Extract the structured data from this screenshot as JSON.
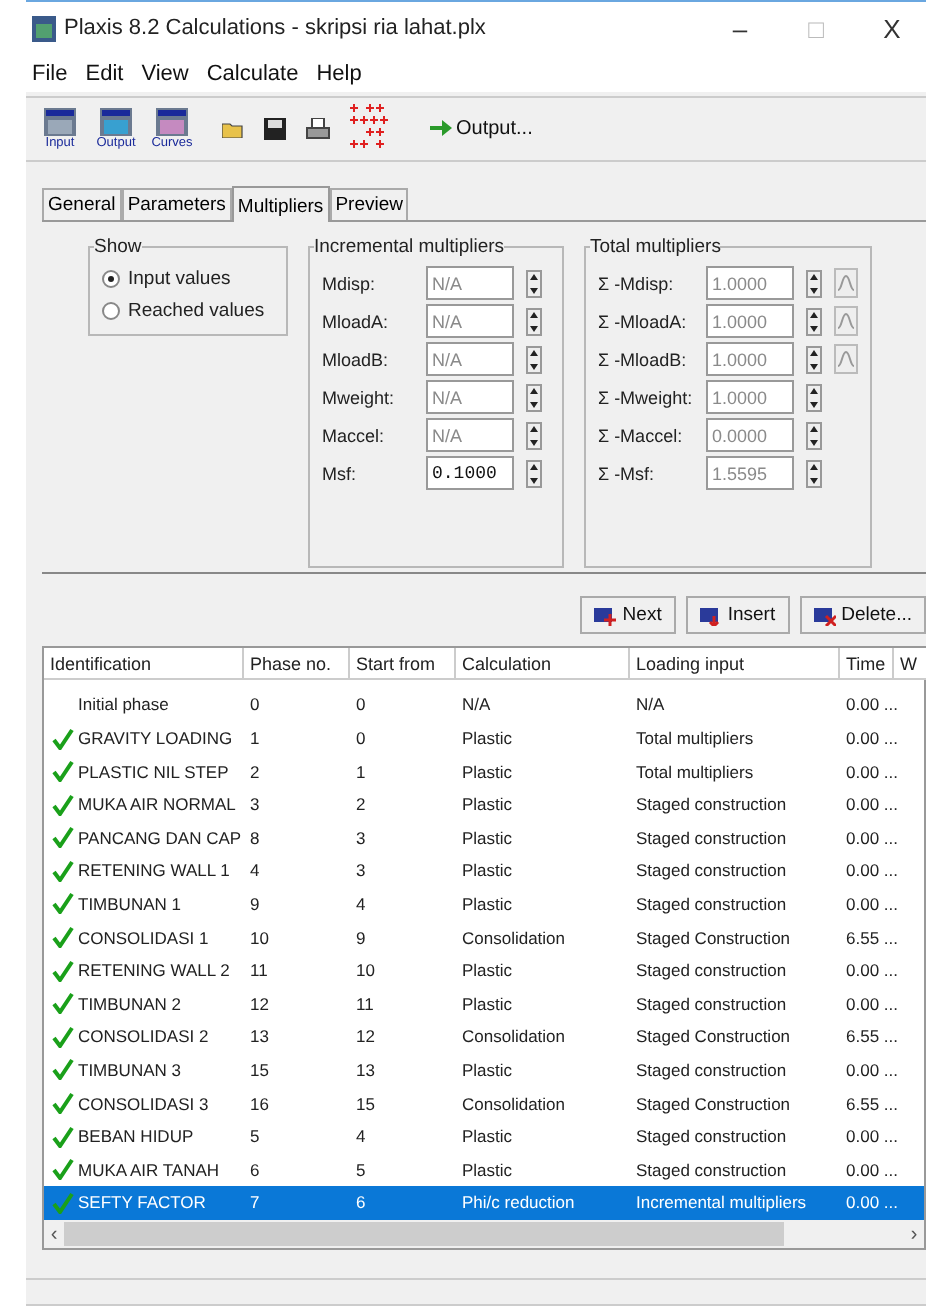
{
  "window": {
    "title": "Plaxis 8.2 Calculations - skripsi ria lahat.plx",
    "controls": [
      "–",
      "□",
      "X"
    ]
  },
  "menu": [
    "File",
    "Edit",
    "View",
    "Calculate",
    "Help"
  ],
  "toolbar": [
    {
      "kind": "big",
      "label": "Input"
    },
    {
      "kind": "big",
      "label": "Output"
    },
    {
      "kind": "big",
      "label": "Curves"
    },
    {
      "kind": "open"
    },
    {
      "kind": "save"
    },
    {
      "kind": "print"
    },
    {
      "kind": "grid"
    },
    {
      "kind": "output",
      "label": "Output..."
    }
  ],
  "tabs": [
    {
      "label": "General",
      "selected": false
    },
    {
      "label": "Parameters",
      "selected": false
    },
    {
      "label": "Multipliers",
      "selected": true
    },
    {
      "label": "Preview",
      "selected": false
    }
  ],
  "show": {
    "title": "Show",
    "options": [
      {
        "label": "Input values",
        "selected": true
      },
      {
        "label": "Reached values",
        "selected": false
      }
    ]
  },
  "incremental": {
    "title": "Incremental multipliers",
    "fields": [
      {
        "label": "Mdisp:",
        "value": "N/A",
        "disabled": true
      },
      {
        "label": "MloadA:",
        "value": "N/A",
        "disabled": true
      },
      {
        "label": "MloadB:",
        "value": "N/A",
        "disabled": true
      },
      {
        "label": "Mweight:",
        "value": "N/A",
        "disabled": true
      },
      {
        "label": "Maccel:",
        "value": "N/A",
        "disabled": true
      },
      {
        "label": "Msf:",
        "value": "0.1000",
        "disabled": false
      }
    ]
  },
  "total": {
    "title": "Total multipliers",
    "fields": [
      {
        "label": "Σ -Mdisp:",
        "value": "1.0000",
        "wave": true
      },
      {
        "label": "Σ -MloadA:",
        "value": "1.0000",
        "wave": true
      },
      {
        "label": "Σ -MloadB:",
        "value": "1.0000",
        "wave": true
      },
      {
        "label": "Σ -Mweight:",
        "value": "1.0000",
        "wave": false
      },
      {
        "label": "Σ -Maccel:",
        "value": "0.0000",
        "wave": false
      },
      {
        "label": "Σ -Msf:",
        "value": "1.5595",
        "wave": false
      }
    ]
  },
  "buttons": [
    {
      "kind": "next",
      "label": "Next"
    },
    {
      "kind": "insert",
      "label": "Insert"
    },
    {
      "kind": "delete",
      "label": "Delete..."
    }
  ],
  "table": {
    "columns": [
      "Identification",
      "Phase no.",
      "Start from",
      "Calculation",
      "Loading input",
      "Time",
      "W"
    ],
    "rows": [
      {
        "checked": false,
        "selected": false,
        "cells": [
          "Initial phase",
          "0",
          "0",
          "N/A",
          "N/A",
          "0.00 ..."
        ]
      },
      {
        "checked": true,
        "selected": false,
        "cells": [
          "GRAVITY LOADING",
          "1",
          "0",
          "Plastic",
          "Total multipliers",
          "0.00 ..."
        ]
      },
      {
        "checked": true,
        "selected": false,
        "cells": [
          "PLASTIC NIL STEP",
          "2",
          "1",
          "Plastic",
          "Total multipliers",
          "0.00 ..."
        ]
      },
      {
        "checked": true,
        "selected": false,
        "cells": [
          "MUKA AIR NORMAL",
          "3",
          "2",
          "Plastic",
          "Staged construction",
          "0.00 ..."
        ]
      },
      {
        "checked": true,
        "selected": false,
        "cells": [
          "PANCANG DAN CAP",
          "8",
          "3",
          "Plastic",
          "Staged construction",
          "0.00 ..."
        ]
      },
      {
        "checked": true,
        "selected": false,
        "cells": [
          "RETENING WALL 1",
          "4",
          "3",
          "Plastic",
          "Staged construction",
          "0.00 ..."
        ]
      },
      {
        "checked": true,
        "selected": false,
        "cells": [
          "TIMBUNAN 1",
          "9",
          "4",
          "Plastic",
          "Staged construction",
          "0.00 ..."
        ]
      },
      {
        "checked": true,
        "selected": false,
        "cells": [
          "CONSOLIDASI 1",
          "10",
          "9",
          "Consolidation",
          "Staged Construction",
          "6.55 ..."
        ]
      },
      {
        "checked": true,
        "selected": false,
        "cells": [
          "RETENING WALL 2",
          "11",
          "10",
          "Plastic",
          "Staged construction",
          "0.00 ..."
        ]
      },
      {
        "checked": true,
        "selected": false,
        "cells": [
          "TIMBUNAN 2",
          "12",
          "11",
          "Plastic",
          "Staged construction",
          "0.00 ..."
        ]
      },
      {
        "checked": true,
        "selected": false,
        "cells": [
          "CONSOLIDASI 2",
          "13",
          "12",
          "Consolidation",
          "Staged Construction",
          "6.55 ..."
        ]
      },
      {
        "checked": true,
        "selected": false,
        "cells": [
          "TIMBUNAN 3",
          "15",
          "13",
          "Plastic",
          "Staged construction",
          "0.00 ..."
        ]
      },
      {
        "checked": true,
        "selected": false,
        "cells": [
          "CONSOLIDASI 3",
          "16",
          "15",
          "Consolidation",
          "Staged Construction",
          "6.55 ..."
        ]
      },
      {
        "checked": true,
        "selected": false,
        "cells": [
          "BEBAN HIDUP",
          "5",
          "4",
          "Plastic",
          "Staged construction",
          "0.00 ..."
        ]
      },
      {
        "checked": true,
        "selected": false,
        "cells": [
          "MUKA AIR TANAH",
          "6",
          "5",
          "Plastic",
          "Staged construction",
          "0.00 ..."
        ]
      },
      {
        "checked": true,
        "selected": true,
        "cells": [
          "SEFTY FACTOR",
          "7",
          "6",
          "Phi/c reduction",
          "Incremental multipliers",
          "0.00 ..."
        ]
      }
    ]
  },
  "scrollbar": {
    "left": "‹",
    "right": "›"
  }
}
